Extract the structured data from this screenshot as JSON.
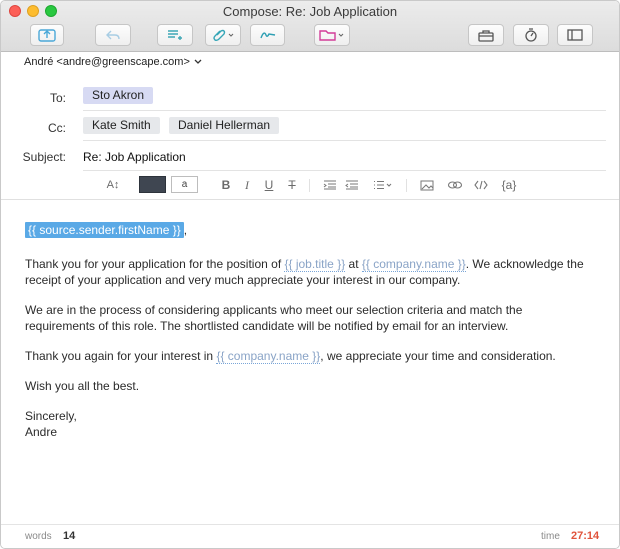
{
  "window": {
    "title": "Compose: Re: Job Application"
  },
  "toolbar": {
    "buttons": [
      {
        "name": "send-icon"
      },
      {
        "name": "reply-icon"
      },
      {
        "name": "format-list-icon"
      },
      {
        "name": "attach-icon"
      },
      {
        "name": "signature-icon"
      },
      {
        "name": "folder-icon"
      },
      {
        "name": "toolbox-icon"
      },
      {
        "name": "timer-icon"
      },
      {
        "name": "sidebar-icon"
      }
    ]
  },
  "from": {
    "value": "André <andre@greenscape.com>"
  },
  "fields": {
    "to_label": "To:",
    "to": [
      "Sto Akron"
    ],
    "cc_label": "Cc:",
    "cc": [
      "Kate Smith",
      "Daniel Hellerman"
    ],
    "subject_label": "Subject:",
    "subject": "Re: Job Application"
  },
  "format_bar": {
    "font_size_label": "A↕",
    "bg_label": "a",
    "bold": "B",
    "italic": "I",
    "underline": "U",
    "clear": "T",
    "variable_label": "{a}",
    "text_color": "#3f4651"
  },
  "body": {
    "greeting_var": "{{ source.sender.firstName }}",
    "greeting_suffix": ",",
    "p1_a": "Thank you for your application for the position of ",
    "p1_var1": "{{ job.title }}",
    "p1_b": " at ",
    "p1_var2": "{{ company.name }}",
    "p1_c": ". We acknowledge the receipt of your application and very much appreciate your interest in our company.",
    "p2": "We are in the process of considering applicants who meet our selection criteria and match the requirements of this role. The shortlisted candidate will be notified by email for an interview.",
    "p3_a": "Thank you again for your interest in ",
    "p3_var": "{{ company.name }}",
    "p3_b": ", we appreciate your time and consideration.",
    "p4": "Wish you all the best.",
    "closing": "Sincerely,",
    "signature": "Andre"
  },
  "status": {
    "words_label": "words",
    "words_value": "14",
    "time_label": "time",
    "time_value": "27:14",
    "time_color": "#e0533b"
  }
}
